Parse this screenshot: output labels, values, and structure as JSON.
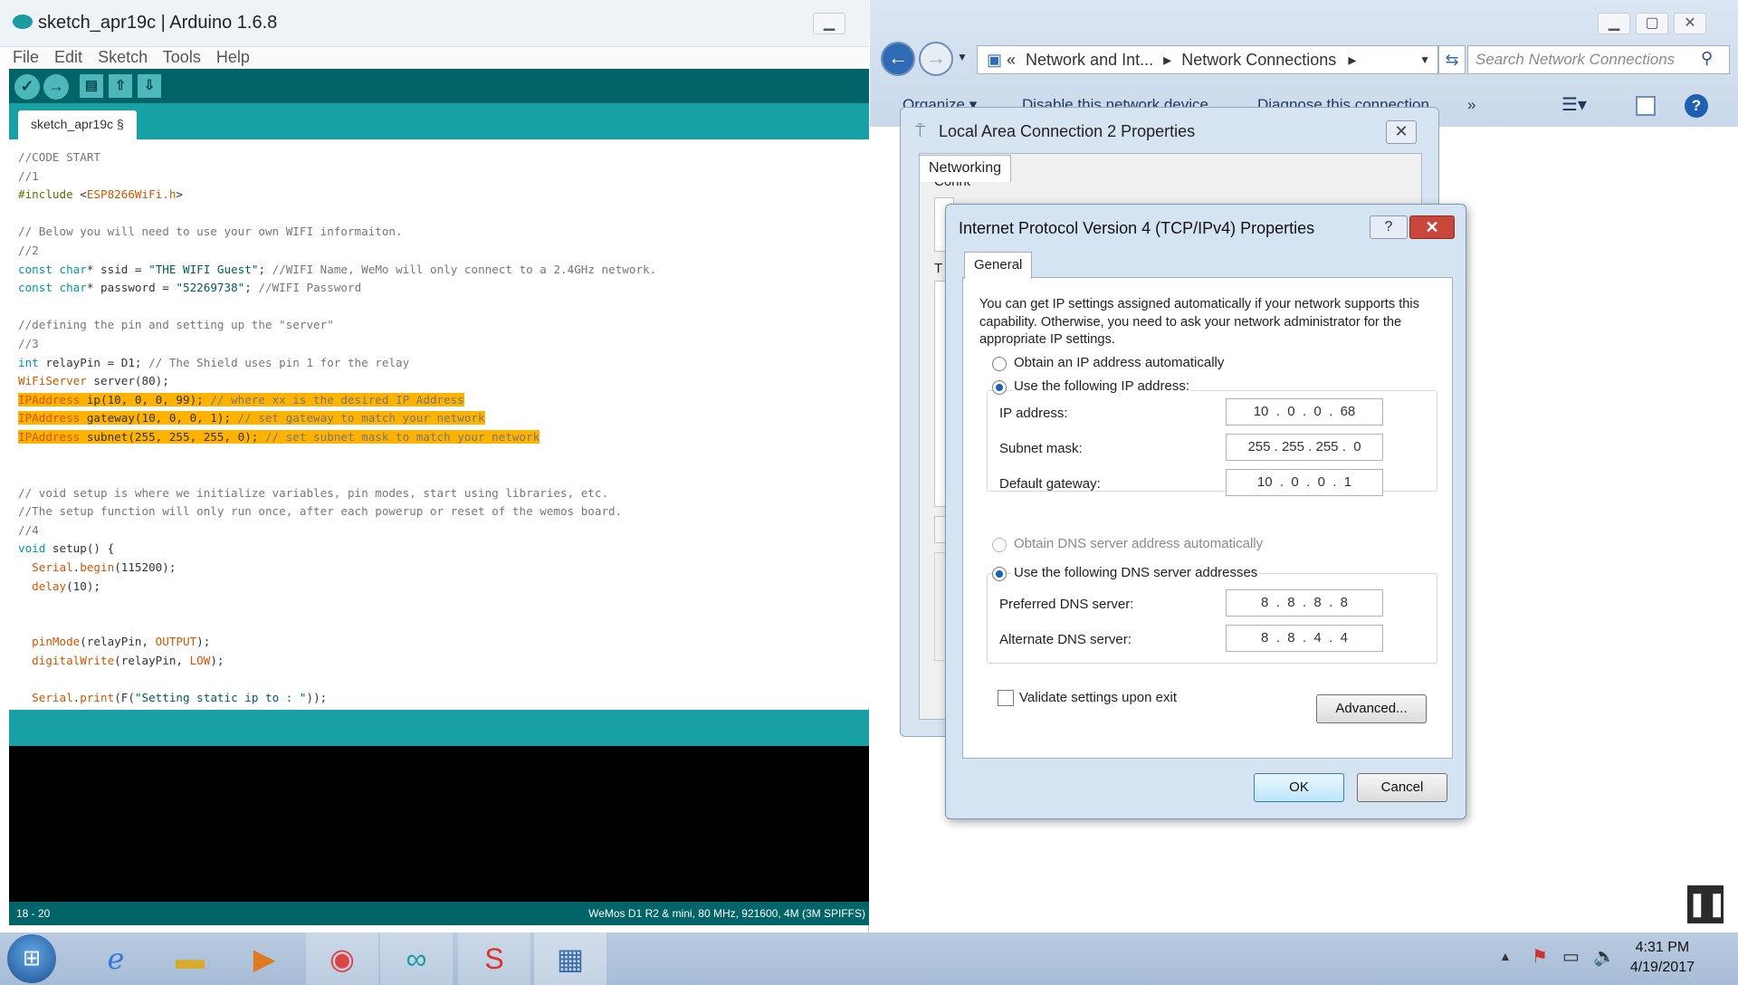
{
  "arduino": {
    "window_title": "sketch_apr19c | Arduino 1.6.8",
    "menu": [
      "File",
      "Edit",
      "Sketch",
      "Tools",
      "Help"
    ],
    "toolbar": {
      "verify_icon": "checkmark-icon",
      "upload_icon": "arrow-right-icon",
      "new_icon": "new-file-icon",
      "open_icon": "open-arrow-up-icon",
      "save_icon": "save-arrow-down-icon"
    },
    "tab_label": "sketch_apr19c §",
    "code_lines": [
      "//CODE START",
      "//1",
      "#include <ESP8266WiFi.h>",
      "",
      "// Below you will need to use your own WIFI informaiton.",
      "//2",
      "const char* ssid = \"THE WIFI Guest\"; //WIFI Name, WeMo will only connect to a 2.4GHz network.",
      "const char* password = \"52269738\"; //WIFI Password",
      "",
      "//defining the pin and setting up the \"server\"",
      "//3",
      "int relayPin = D1; // The Shield uses pin 1 for the relay",
      "WiFiServer server(80);",
      "IPAddress ip(10, 0, 0, 99); // where xx is the desired IP Address",
      "IPAddress gateway(10, 0, 0, 1); // set gateway to match your network",
      "IPAddress subnet(255, 255, 255, 0); // set subnet mask to match your network",
      "",
      "",
      "// void setup is where we initialize variables, pin modes, start using libraries, etc.",
      "//The setup function will only run once, after each powerup or reset of the wemos board.",
      "//4",
      "void setup() {",
      "  Serial.begin(115200);",
      "  delay(10);",
      "",
      "",
      "  pinMode(relayPin, OUTPUT);",
      "  digitalWrite(relayPin, LOW);",
      "",
      "  Serial.print(F(\"Setting static ip to : \"));"
    ],
    "highlighted_lines": [
      13,
      14,
      15
    ],
    "status_left": "18 - 20",
    "status_right": "WeMos D1 R2 & mini, 80 MHz, 921600, 4M (3M SPIFFS)",
    "colors": {
      "teal_dark": "#006468",
      "teal": "#17a1a5",
      "highlight": "#ffb300"
    }
  },
  "explorer": {
    "breadcrumb": [
      "«",
      "Network and Int...",
      "▸",
      "Network Connections",
      "▸"
    ],
    "search_placeholder": "Search Network Connections",
    "commands": [
      "Organize ▾",
      "Disable this network device",
      "Diagnose this connection",
      "»"
    ]
  },
  "lac_dialog": {
    "title": "Local Area Connection 2 Properties",
    "tab": "Networking",
    "partial_text": "Connect using:",
    "partial_letter": "T"
  },
  "ipv4_dialog": {
    "title": "Internet Protocol Version 4 (TCP/IPv4) Properties",
    "help": "?",
    "close": "✕",
    "tab": "General",
    "description": "You can get IP settings assigned automatically if your network supports this capability. Otherwise, you need to ask your network administrator for the appropriate IP settings.",
    "ip_auto_label": "Obtain an IP address automatically",
    "ip_manual_label": "Use the following IP address:",
    "ip_fields": [
      {
        "label": "IP address:",
        "value": "10  .  0  .  0  .  68"
      },
      {
        "label": "Subnet mask:",
        "value": "255 . 255 . 255 .  0"
      },
      {
        "label": "Default gateway:",
        "value": "10  .  0  .  0  .  1"
      }
    ],
    "dns_auto_label": "Obtain DNS server address automatically",
    "dns_manual_label": "Use the following DNS server addresses",
    "dns_fields": [
      {
        "label": "Preferred DNS server:",
        "value": "8  .  8  .  8  .  8"
      },
      {
        "label": "Alternate DNS server:",
        "value": "8  .  8  .  4  .  4"
      }
    ],
    "validate_label": "Validate settings upon exit",
    "advanced_label": "Advanced...",
    "ok_label": "OK",
    "cancel_label": "Cancel"
  },
  "taskbar": {
    "time": "4:31 PM",
    "date": "4/19/2017",
    "apps": [
      "internet-explorer-icon",
      "file-explorer-icon",
      "media-player-icon",
      "chrome-icon",
      "arduino-icon",
      "snagit-icon",
      "network-settings-icon"
    ]
  }
}
